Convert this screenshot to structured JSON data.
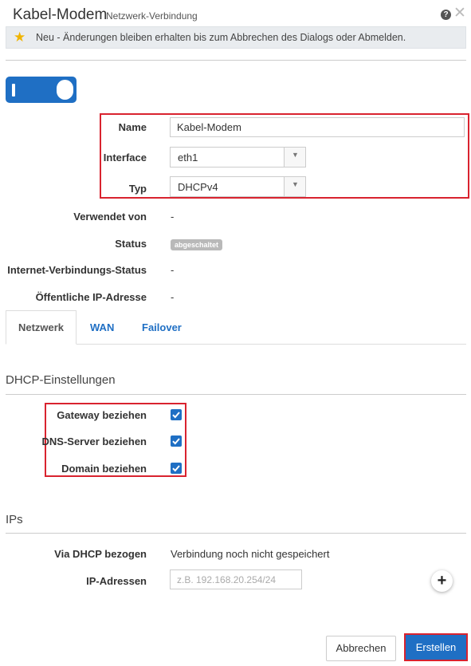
{
  "header": {
    "title": "Kabel-Modem",
    "subtitle": "Netzwerk-Verbindung",
    "help_icon": "?",
    "close_icon": "✕"
  },
  "notice": {
    "text": "Neu - Änderungen bleiben erhalten bis zum Abbrechen des Dialogs oder Abmelden.",
    "icon": "star-icon"
  },
  "toggle": {
    "state": "on"
  },
  "form": {
    "name_label": "Name",
    "name_value": "Kabel-Modem",
    "interface_label": "Interface",
    "interface_value": "eth1",
    "type_label": "Typ",
    "type_value": "DHCPv4",
    "used_by_label": "Verwendet von",
    "used_by_value": "-",
    "status_label": "Status",
    "status_value": "abgeschaltet",
    "internet_status_label": "Internet-Verbindungs-Status",
    "internet_status_value": "-",
    "public_ip_label": "Öffentliche IP-Adresse",
    "public_ip_value": "-"
  },
  "tabs": [
    {
      "label": "Netzwerk",
      "active": true
    },
    {
      "label": "WAN",
      "active": false
    },
    {
      "label": "Failover",
      "active": false
    }
  ],
  "dhcp": {
    "section_title": "DHCP-Einstellungen",
    "gateway_label": "Gateway beziehen",
    "dns_label": "DNS-Server beziehen",
    "domain_label": "Domain beziehen",
    "gateway_checked": true,
    "dns_checked": true,
    "domain_checked": true
  },
  "ips": {
    "section_title": "IPs",
    "via_dhcp_label": "Via DHCP bezogen",
    "via_dhcp_value": "Verbindung noch nicht gespeichert",
    "ip_addresses_label": "IP-Adressen",
    "ip_addresses_placeholder": "z.B. 192.168.20.254/24",
    "add_label": "+"
  },
  "buttons": {
    "cancel": "Abbrechen",
    "create": "Erstellen"
  },
  "colors": {
    "accent": "#1f6fc4",
    "highlight": "#d9232f",
    "badge": "#b9b9b9"
  }
}
